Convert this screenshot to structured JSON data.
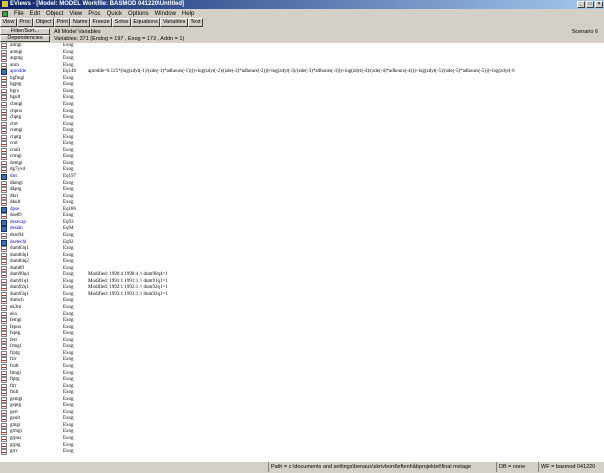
{
  "window": {
    "title": "EViews - [Model: MODEL   Workfile: BASMOD 041220\\Untitled]"
  },
  "menu": [
    "File",
    "Edit",
    "Object",
    "View",
    "Proc",
    "Quick",
    "Options",
    "Window",
    "Help"
  ],
  "toolbar": [
    "View",
    "Proc",
    "Object",
    "Print",
    "Name",
    "Freeze",
    "Solve",
    "Equations",
    "Variables",
    "Text"
  ],
  "panel_buttons": {
    "filter": "Filter/Sort...",
    "deps": "Dependencies"
  },
  "header": {
    "title": "All Model Variables",
    "subtitle": "Variables: 371  (Endog = 197 , Exog = 173 , Addn = 1)",
    "scenario": "Scenario 6"
  },
  "rows": [
    {
      "name": "afmgi",
      "type": "Exog",
      "icon": "x"
    },
    {
      "name": "anmgi",
      "type": "Exog",
      "icon": "x"
    },
    {
      "name": "argmg",
      "type": "Exog",
      "icon": "x"
    },
    {
      "name": "anrn",
      "type": "Exog",
      "icon": "x"
    },
    {
      "name": "aprodde",
      "type": "Eq148",
      "icon": "eq",
      "blue": true,
      "desc": "aprodde=0.125*(log(zdyt(-1)/(zde(-1)*adhours(-1))))+log(zdyt(-2)/(zde(-2)*adhours(-2)))+log(zdyt(-3)/(zde(-3)*adhours(-3)))+log(zdyt(-4)/(zde(-4)*adhours(-4)))+log(zdyt(-5)/(zde(-5)*adhours(-5)))+log(zdyt(-6"
    },
    {
      "name": "bgfmgi",
      "type": "Exog",
      "icon": "x"
    },
    {
      "name": "bgptg",
      "type": "Exog",
      "icon": "x"
    },
    {
      "name": "bgrx",
      "type": "Exog",
      "icon": "x"
    },
    {
      "name": "bgult",
      "type": "Exog",
      "icon": "x"
    },
    {
      "name": "cbmgi",
      "type": "Exog",
      "icon": "x"
    },
    {
      "name": "cbpnx",
      "type": "Exog",
      "icon": "x"
    },
    {
      "name": "cbptg",
      "type": "Exog",
      "icon": "x"
    },
    {
      "name": "cbrt",
      "type": "Exog",
      "icon": "x"
    },
    {
      "name": "cnmgi",
      "type": "Exog",
      "icon": "x"
    },
    {
      "name": "cnptg",
      "type": "Exog",
      "icon": "x"
    },
    {
      "name": "cnrt",
      "type": "Exog",
      "icon": "x"
    },
    {
      "name": "cnult",
      "type": "Exog",
      "icon": "x"
    },
    {
      "name": "crmgi",
      "type": "Exog",
      "icon": "x"
    },
    {
      "name": "demgi",
      "type": "Exog",
      "icon": "x"
    },
    {
      "name": "dg7yvd",
      "type": "Exog",
      "icon": "x"
    },
    {
      "name": "dirt",
      "type": "Eq197",
      "icon": "eq",
      "blue": true
    },
    {
      "name": "dkmgi",
      "type": "Exog",
      "icon": "x"
    },
    {
      "name": "dkptg",
      "type": "Exog",
      "icon": "x"
    },
    {
      "name": "dkrr",
      "type": "Exog",
      "icon": "x"
    },
    {
      "name": "dkult",
      "type": "Exog",
      "icon": "x"
    },
    {
      "name": "dpse",
      "type": "Eq186",
      "icon": "eq",
      "blue": true
    },
    {
      "name": "dse89",
      "type": "Exog",
      "icon": "x"
    },
    {
      "name": "desecap",
      "type": "Eq93",
      "icon": "eq",
      "blue": true
    },
    {
      "name": "deslab",
      "type": "Eq94",
      "icon": "eq",
      "blue": true
    },
    {
      "name": "dsse94",
      "type": "Exog",
      "icon": "x"
    },
    {
      "name": "dsetechl",
      "type": "Eq92",
      "icon": "eq",
      "blue": true
    },
    {
      "name": "dum83q1",
      "type": "Exog",
      "icon": "x"
    },
    {
      "name": "dum84q1",
      "type": "Exog",
      "icon": "x"
    },
    {
      "name": "dum84q2",
      "type": "Exog",
      "icon": "x"
    },
    {
      "name": "dum89",
      "type": "Exog",
      "icon": "x"
    },
    {
      "name": "dum90q4",
      "type": "Exog",
      "icon": "x",
      "desc": "Modified: 1990:4 1990:4 // dum90q4=1"
    },
    {
      "name": "dum91q1",
      "type": "Exog",
      "icon": "x",
      "desc": "Modified: 1991:1 1991:1 // dum91q1=1"
    },
    {
      "name": "dum92q1",
      "type": "Exog",
      "icon": "x",
      "desc": "Modified: 1992:1 1992:1 // dum92q1=1"
    },
    {
      "name": "dum93q1",
      "type": "Exog",
      "icon": "x",
      "desc": "Modified: 1993:1 1993:1 // dum93q1=1"
    },
    {
      "name": "dumch",
      "type": "Exog",
      "icon": "x"
    },
    {
      "name": "ek3m",
      "type": "Exog",
      "icon": "x"
    },
    {
      "name": "ekx",
      "type": "Exog",
      "icon": "x"
    },
    {
      "name": "femgi",
      "type": "Exog",
      "icon": "x"
    },
    {
      "name": "fepnx",
      "type": "Exog",
      "icon": "x"
    },
    {
      "name": "feptg",
      "type": "Exog",
      "icon": "x"
    },
    {
      "name": "ferr",
      "type": "Exog",
      "icon": "x"
    },
    {
      "name": "frmgi",
      "type": "Exog",
      "icon": "x"
    },
    {
      "name": "frptg",
      "type": "Exog",
      "icon": "x"
    },
    {
      "name": "frrr",
      "type": "Exog",
      "icon": "x"
    },
    {
      "name": "frult",
      "type": "Exog",
      "icon": "x"
    },
    {
      "name": "ftmgi",
      "type": "Exog",
      "icon": "x"
    },
    {
      "name": "ftptg",
      "type": "Exog",
      "icon": "x"
    },
    {
      "name": "ftrr",
      "type": "Exog",
      "icon": "x"
    },
    {
      "name": "ftult",
      "type": "Exog",
      "icon": "x"
    },
    {
      "name": "gemgi",
      "type": "Exog",
      "icon": "x"
    },
    {
      "name": "geptg",
      "type": "Exog",
      "icon": "x"
    },
    {
      "name": "gerr",
      "type": "Exog",
      "icon": "x"
    },
    {
      "name": "geult",
      "type": "Exog",
      "icon": "x"
    },
    {
      "name": "gmgi",
      "type": "Exog",
      "icon": "x"
    },
    {
      "name": "grmgi",
      "type": "Exog",
      "icon": "x"
    },
    {
      "name": "grpnx",
      "type": "Exog",
      "icon": "x"
    },
    {
      "name": "grptg",
      "type": "Exog",
      "icon": "x"
    },
    {
      "name": "grrr",
      "type": "Exog",
      "icon": "x"
    }
  ],
  "status": {
    "path": "Path = c:\\documents and settings\\benaus\\skrivbord\\eftenhåbprojektet\\final mstage",
    "db": "DB = none",
    "wf": "WF = basmod 041220"
  }
}
